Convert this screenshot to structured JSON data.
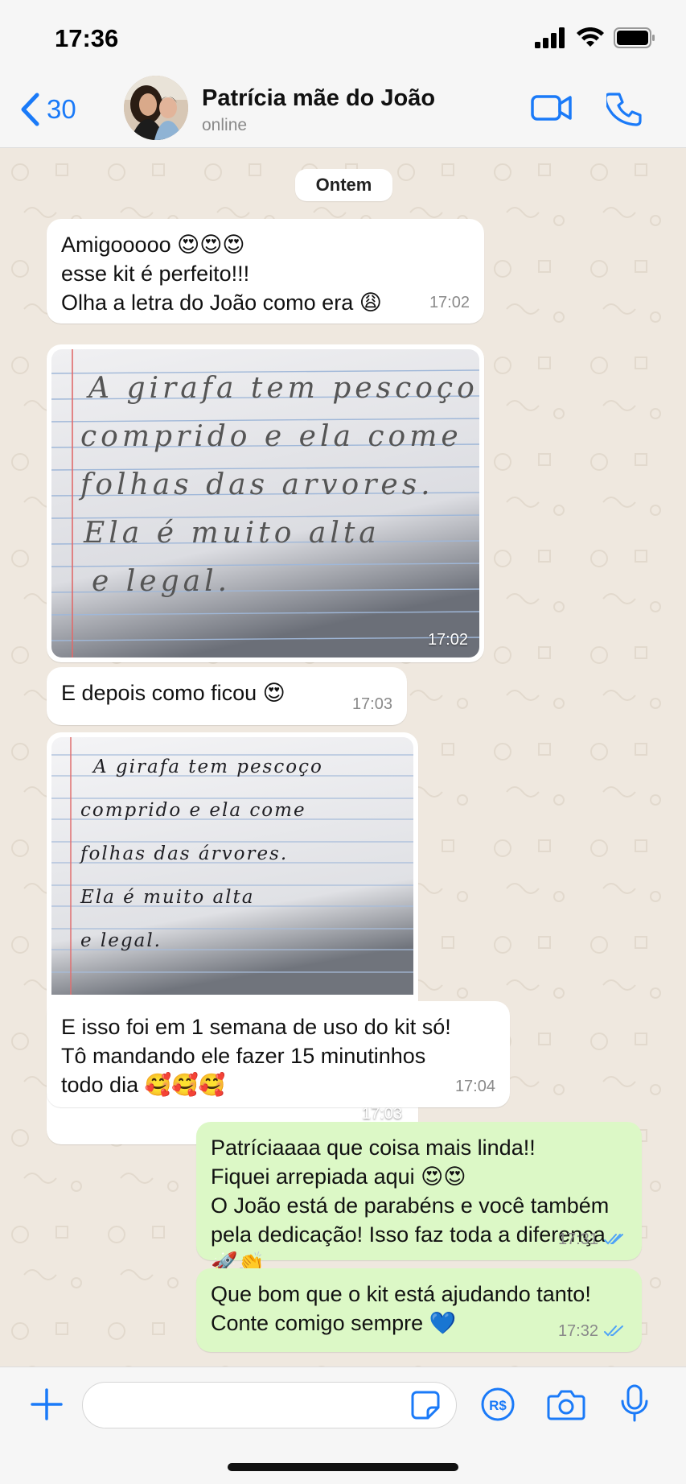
{
  "status": {
    "time": "17:36"
  },
  "header": {
    "back_count": "30",
    "contact_name": "Patrícia mãe do João",
    "contact_status": "online"
  },
  "chat": {
    "day_label": "Ontem",
    "messages": [
      {
        "direction": "in",
        "type": "text",
        "text": "Amigooooo 😍😍😍\nesse kit é perfeito!!!\nOlha a letra do João como era 😩",
        "time": "17:02"
      },
      {
        "direction": "in",
        "type": "image",
        "time": "17:02",
        "handwriting": [
          "A girafa tem pescoço",
          "comprido e ela come",
          "folhas das arvores.",
          "Ela é muito alta",
          "e legal."
        ]
      },
      {
        "direction": "in",
        "type": "text",
        "text": "E depois como ficou 😍",
        "time": "17:03"
      },
      {
        "direction": "in",
        "type": "image",
        "time": "17:03",
        "handwriting": [
          "A girafa tem pescoço",
          "comprido e ela come",
          "folhas das árvores.",
          "Ela é muito alta",
          "e legal."
        ]
      },
      {
        "direction": "in",
        "type": "text",
        "text": "E isso foi em 1 semana de uso do kit só!\nTô mandando ele fazer 15 minutinhos\ntodo dia 🥰🥰🥰",
        "time": "17:04"
      },
      {
        "direction": "out",
        "type": "text",
        "text": "Patríciaaaa que coisa mais linda!!\nFiquei arrepiada aqui 😍😍\nO João está de parabéns e você também\npela dedicação! Isso faz toda a diferença\n🚀👏",
        "time": "17:31",
        "status": "read"
      },
      {
        "direction": "out",
        "type": "text",
        "text": "Que bom que o kit está ajudando tanto!\nConte comigo sempre 💙",
        "time": "17:32",
        "status": "read"
      }
    ]
  },
  "input_bar": {
    "message_value": "",
    "placeholder": ""
  },
  "icons": {
    "back": "chevron-left-icon",
    "video": "video-camera-icon",
    "call": "phone-icon",
    "add": "plus-icon",
    "sticker": "sticker-icon",
    "payment": "pix-real-icon",
    "camera": "camera-icon",
    "mic": "microphone-icon"
  },
  "colors": {
    "accent": "#1a7af8",
    "outgoing_bubble": "#dcf8c6",
    "incoming_bubble": "#ffffff",
    "chat_background": "#efe8df",
    "read_ticks": "#4fa3f7"
  }
}
